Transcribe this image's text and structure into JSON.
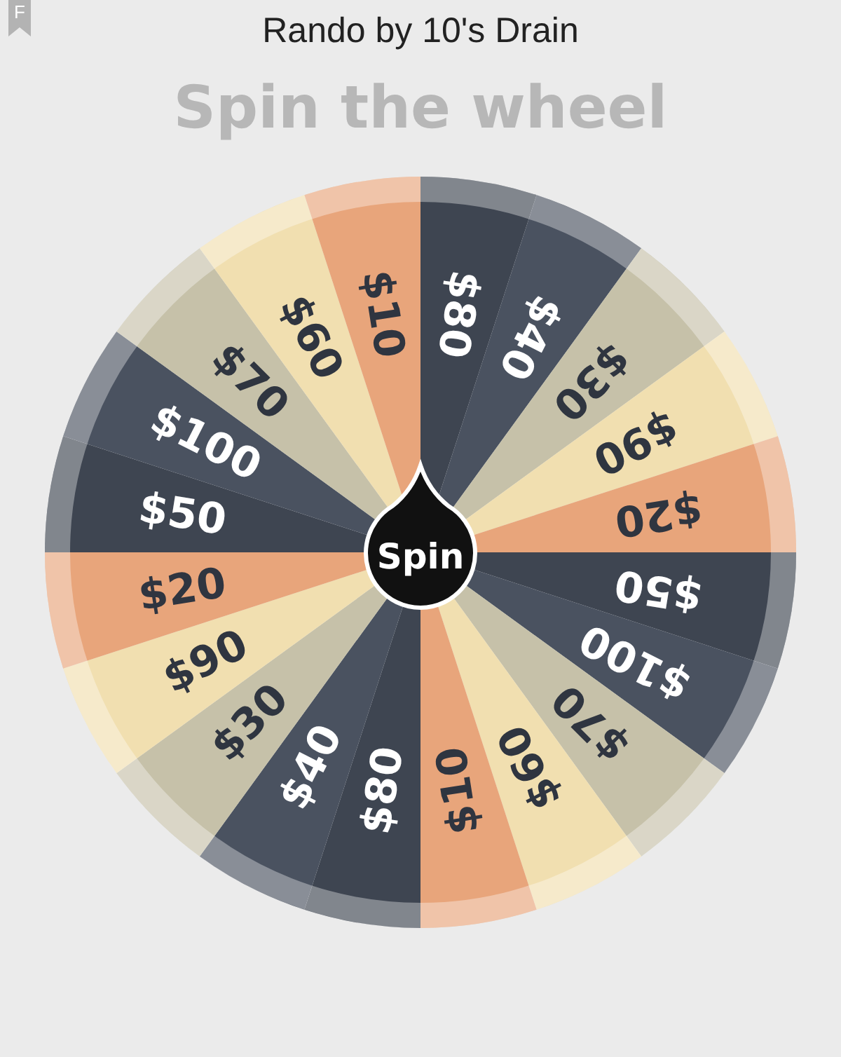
{
  "badge": "F",
  "title": "Rando by 10's Drain",
  "heading": "Spin the wheel",
  "wheel": {
    "segments": [
      {
        "label": "$80",
        "color": "#3e4551"
      },
      {
        "label": "$40",
        "color": "#4a5260"
      },
      {
        "label": "$30",
        "color": "#c6c1a9"
      },
      {
        "label": "$90",
        "color": "#f1dfb0"
      },
      {
        "label": "$20",
        "color": "#e8a57b"
      },
      {
        "label": "$50",
        "color": "#3e4551"
      },
      {
        "label": "$100",
        "color": "#4a5260"
      },
      {
        "label": "$70",
        "color": "#c6c1a9"
      },
      {
        "label": "$60",
        "color": "#f1dfb0"
      },
      {
        "label": "$10",
        "color": "#e8a57b"
      },
      {
        "label": "$80",
        "color": "#3e4551"
      },
      {
        "label": "$40",
        "color": "#4a5260"
      },
      {
        "label": "$30",
        "color": "#c6c1a9"
      },
      {
        "label": "$90",
        "color": "#f1dfb0"
      },
      {
        "label": "$20",
        "color": "#e8a57b"
      },
      {
        "label": "$50",
        "color": "#3e4551"
      },
      {
        "label": "$100",
        "color": "#4a5260"
      },
      {
        "label": "$70",
        "color": "#c6c1a9"
      },
      {
        "label": "$60",
        "color": "#f1dfb0"
      },
      {
        "label": "$10",
        "color": "#e8a57b"
      }
    ]
  },
  "spin_button": "Spin"
}
